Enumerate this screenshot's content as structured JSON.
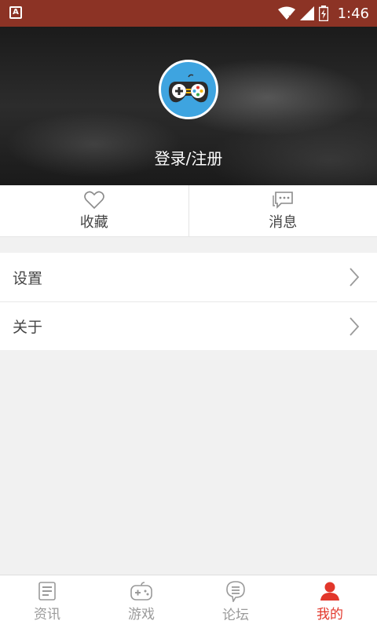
{
  "status_bar": {
    "time": "1:46",
    "left_icon_letter": "A",
    "icons": [
      "wifi-icon",
      "signal-icon",
      "battery-icon"
    ]
  },
  "header": {
    "avatar_icon": "gamepad-icon",
    "login_label": "登录/注册"
  },
  "quick_actions": [
    {
      "label": "收藏",
      "icon": "heart-icon"
    },
    {
      "label": "消息",
      "icon": "message-icon"
    }
  ],
  "menu": [
    {
      "label": "设置",
      "icon": "chevron-right-icon"
    },
    {
      "label": "关于",
      "icon": "chevron-right-icon"
    }
  ],
  "bottom_nav": [
    {
      "label": "资讯",
      "icon": "news-icon",
      "active": false
    },
    {
      "label": "游戏",
      "icon": "gamepad-icon",
      "active": false
    },
    {
      "label": "论坛",
      "icon": "forum-icon",
      "active": false
    },
    {
      "label": "我的",
      "icon": "user-icon",
      "active": true
    }
  ],
  "colors": {
    "status_bar": "#8c3325",
    "accent": "#e2372b",
    "avatar_bg": "#3ea4e0",
    "inactive": "#9a9a9a"
  }
}
